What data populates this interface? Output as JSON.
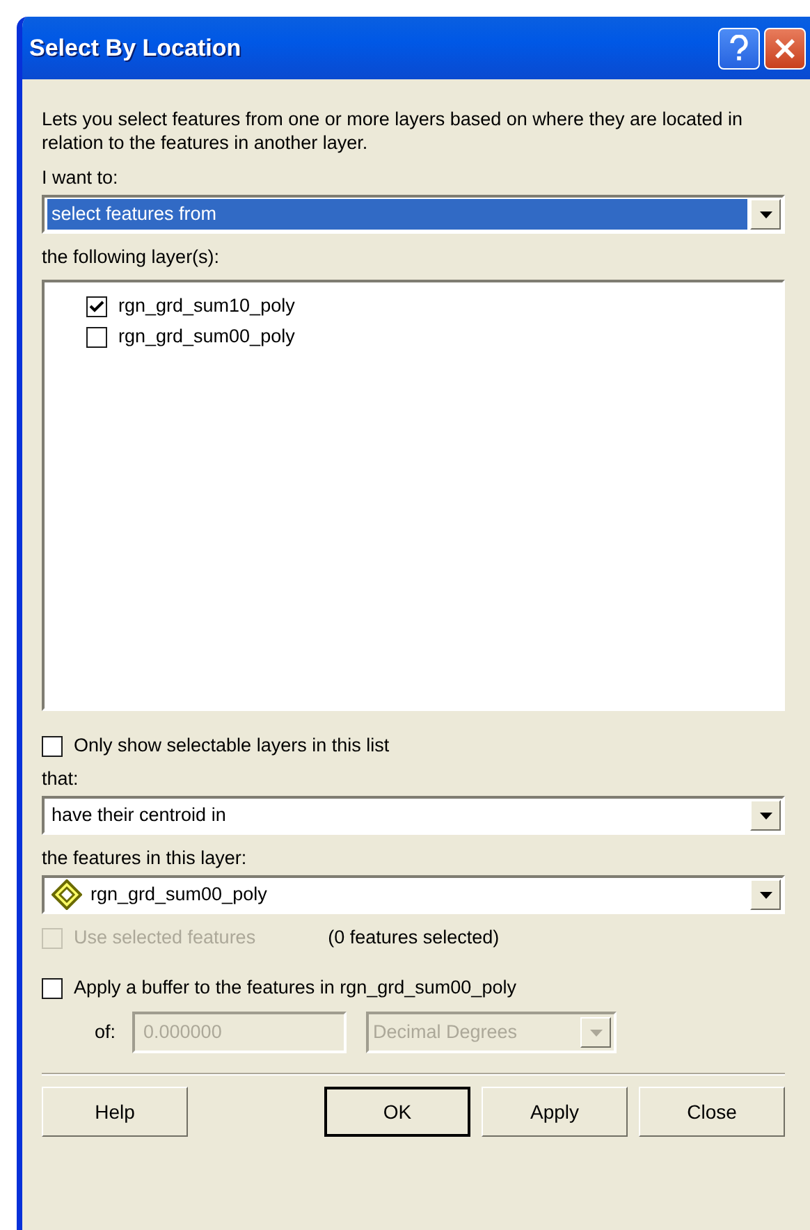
{
  "window": {
    "title": "Select By Location"
  },
  "description": "Lets you select features from one or more layers based on where they are located in relation to the features in another layer.",
  "i_want_to": {
    "label": "I want to:",
    "value": "select features from",
    "focused": true
  },
  "layers": {
    "label": "the following layer(s):",
    "items": [
      {
        "name": "rgn_grd_sum10_poly",
        "checked": true
      },
      {
        "name": "rgn_grd_sum00_poly",
        "checked": false
      }
    ]
  },
  "only_selectable": {
    "label": "Only show selectable layers in this list",
    "checked": false,
    "disabled": false
  },
  "that": {
    "label": "that:",
    "value": "have their centroid in",
    "focused": false
  },
  "source_layer": {
    "label": "the features in this layer:",
    "value": "rgn_grd_sum00_poly",
    "focused": false
  },
  "use_selected": {
    "label": "Use selected features",
    "checked": false,
    "disabled": true
  },
  "selected_count": "(0 features selected)",
  "buffer": {
    "label": "Apply a buffer to the features in rgn_grd_sum00_poly",
    "checked": false,
    "disabled": false
  },
  "buffer_distance": {
    "label": "of:",
    "value": "0.000000",
    "disabled": true
  },
  "buffer_units": {
    "value": "Decimal Degrees",
    "disabled": true
  },
  "buttons": [
    {
      "label": "Help",
      "default": false
    },
    {
      "label": "OK",
      "default": true
    },
    {
      "label": "Apply",
      "default": false
    },
    {
      "label": "Close",
      "default": false
    }
  ]
}
